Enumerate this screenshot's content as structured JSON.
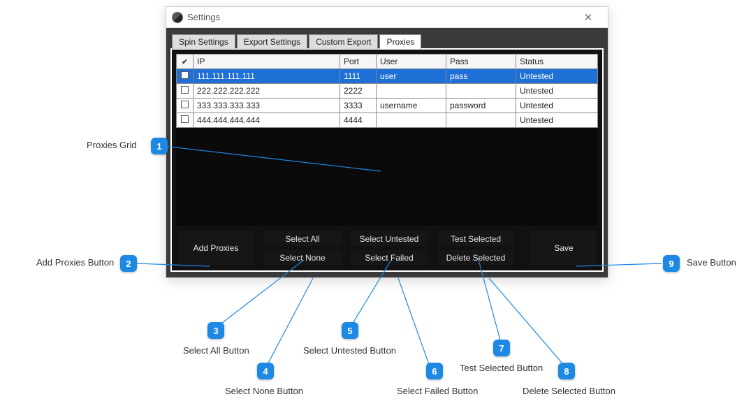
{
  "window": {
    "title": "Settings"
  },
  "tabs": [
    {
      "label": "Spin Settings"
    },
    {
      "label": "Export Settings"
    },
    {
      "label": "Custom Export"
    },
    {
      "label": "Proxies"
    }
  ],
  "grid": {
    "headers": {
      "ip": "IP",
      "port": "Port",
      "user": "User",
      "pass": "Pass",
      "status": "Status"
    },
    "rows": [
      {
        "ip": "111.111.111.111",
        "port": "1111",
        "user": "user",
        "pass": "pass",
        "status": "Untested"
      },
      {
        "ip": "222.222.222.222",
        "port": "2222",
        "user": "",
        "pass": "",
        "status": "Untested"
      },
      {
        "ip": "333.333.333.333",
        "port": "3333",
        "user": "username",
        "pass": "password",
        "status": "Untested"
      },
      {
        "ip": "444.444.444.444",
        "port": "4444",
        "user": "",
        "pass": "",
        "status": "Untested"
      }
    ]
  },
  "buttons": {
    "add": "Add Proxies",
    "select_all": "Select All",
    "select_none": "Select None",
    "select_untested": "Select Untested",
    "select_failed": "Select Failed",
    "test_selected": "Test Selected",
    "delete_selected": "Delete Selected",
    "save": "Save"
  },
  "callouts": {
    "1": "Proxies Grid",
    "2": "Add Proxies Button",
    "3": "Select All Button",
    "4": "Select None Button",
    "5": "Select Untested Button",
    "6": "Select Failed Button",
    "7": "Test Selected Button",
    "8": "Delete Selected Button",
    "9": "Save Button"
  }
}
